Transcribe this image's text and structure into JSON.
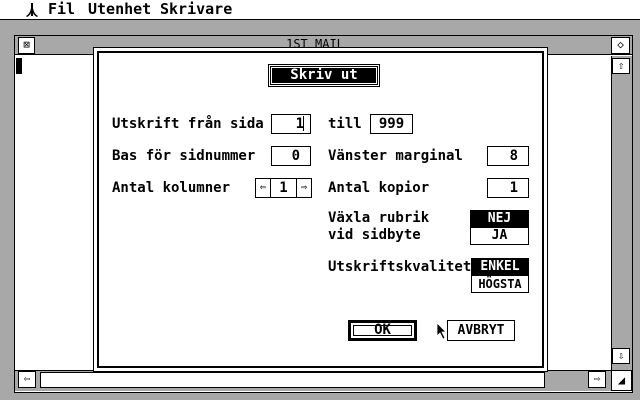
{
  "menubar": {
    "items": [
      "Fil",
      "Utenhet",
      "Skrivare"
    ]
  },
  "window": {
    "title": "1ST_MAIL",
    "close_glyph": "⊠",
    "full_glyph": "◇",
    "up_glyph": "⇧",
    "down_glyph": "⇩",
    "left_glyph": "⇦",
    "right_glyph": "⇨",
    "size_glyph": "◢"
  },
  "dialog": {
    "title": "Skriv ut",
    "from_page_label": "Utskrift från sida",
    "from_page_value": "1",
    "to_label": "till",
    "to_value": "999",
    "page_base_label": "Bas för sidnummer",
    "page_base_value": "0",
    "left_margin_label": "Vänster marginal",
    "left_margin_value": "8",
    "columns_label": "Antal kolumner",
    "columns_value": "1",
    "stepper_left_glyph": "⇦",
    "stepper_right_glyph": "⇨",
    "copies_label": "Antal kopior",
    "copies_value": "1",
    "header_label_line1": "Växla rubrik",
    "header_label_line2": "vid sidbyte",
    "header_options": [
      "NEJ",
      "JA"
    ],
    "header_selected": "NEJ",
    "quality_label": "Utskriftskvalitet",
    "quality_options": [
      "ENKEL",
      "HÖGSTA"
    ],
    "quality_selected": "ENKEL",
    "ok_label": "OK",
    "cancel_label": "AVBRYT"
  },
  "colors": {
    "desktop": "#a8a8a8",
    "foreground": "#000000",
    "background": "#ffffff"
  }
}
